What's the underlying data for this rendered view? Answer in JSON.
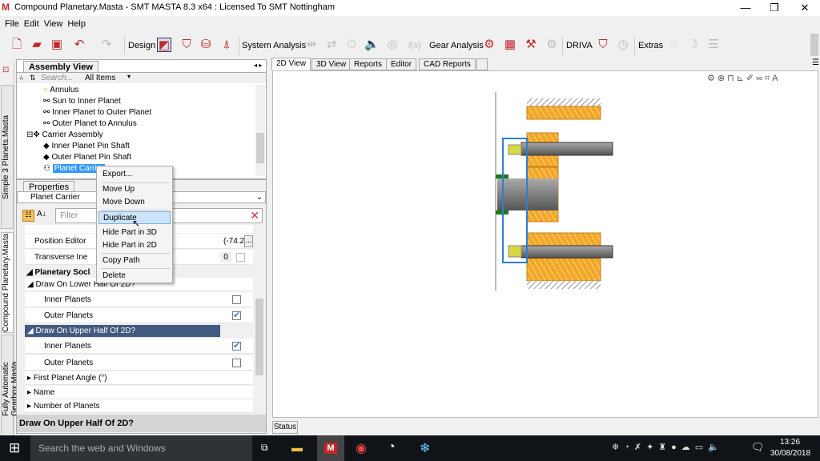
{
  "window": {
    "title": "Compound Planetary.Masta - SMT MASTA 8.3 x64 : Licensed To SMT Nottingham",
    "minimize": "—",
    "maximize": "❐",
    "close": "✕"
  },
  "menu": [
    "File",
    "Edit",
    "View",
    "Help"
  ],
  "toolbar": {
    "design": "Design",
    "system_analysis": "System Analysis",
    "fx": "f(x)",
    "gear_analysis": "Gear Analysis",
    "driva": "DRIVA",
    "extras": "Extras"
  },
  "side_tabs": [
    "Simple 3 Planets.Masta",
    "Compound Planetary.Masta",
    "Fully Automatic Gearbox.Masta"
  ],
  "assembly": {
    "tab": "Assembly View",
    "search_placeholder": "Search...",
    "filter": "All Items",
    "items": [
      "Annulus",
      "Sun to Inner Planet",
      "Inner Planet to Outer Planet",
      "Outer Planet to Annulus",
      "Carrier Assembly",
      "Inner Planet Pin Shaft",
      "Outer Planet Pin Shaft",
      "Planet Carrier"
    ]
  },
  "properties": {
    "tab": "Properties",
    "object": "Planet Carrier",
    "filter_placeholder": "Filter",
    "rows": [
      {
        "label": "Position Editor",
        "value": "(-74.2",
        "button": "..."
      },
      {
        "label": "Transverse Ine",
        "value": "0"
      },
      {
        "label": "Planetary Socl"
      },
      {
        "label": "Draw On Lower Half Of 2D?"
      },
      {
        "label": "Inner Planets",
        "checked": false
      },
      {
        "label": "Outer Planets",
        "checked": true
      },
      {
        "label": "Draw On Upper Half Of 2D?"
      },
      {
        "label": "Inner Planets",
        "checked": true
      },
      {
        "label": "Outer Planets",
        "checked": false
      },
      {
        "label": "First Planet Angle (°)"
      },
      {
        "label": "Name"
      },
      {
        "label": "Number of Planets"
      }
    ],
    "description": "Draw On Upper Half Of 2D?"
  },
  "context_menu": [
    "Export...",
    "Move Up",
    "Move Down",
    "Duplicate",
    "Hide Part in 3D",
    "Hide Part in 2D",
    "Copy Path",
    "Delete"
  ],
  "view_tabs": [
    "2D View",
    "3D View",
    "Reports",
    "Editor",
    "CAD Reports"
  ],
  "status": "Status",
  "taskbar": {
    "search": "Search the web and Windows",
    "time": "13:26",
    "date": "30/08/2018"
  },
  "colors": {
    "accent": "#c0282a",
    "selection": "#435a80",
    "gear": "#f5a623",
    "shaft": "#707070",
    "carrier": "#2a7fd4"
  }
}
